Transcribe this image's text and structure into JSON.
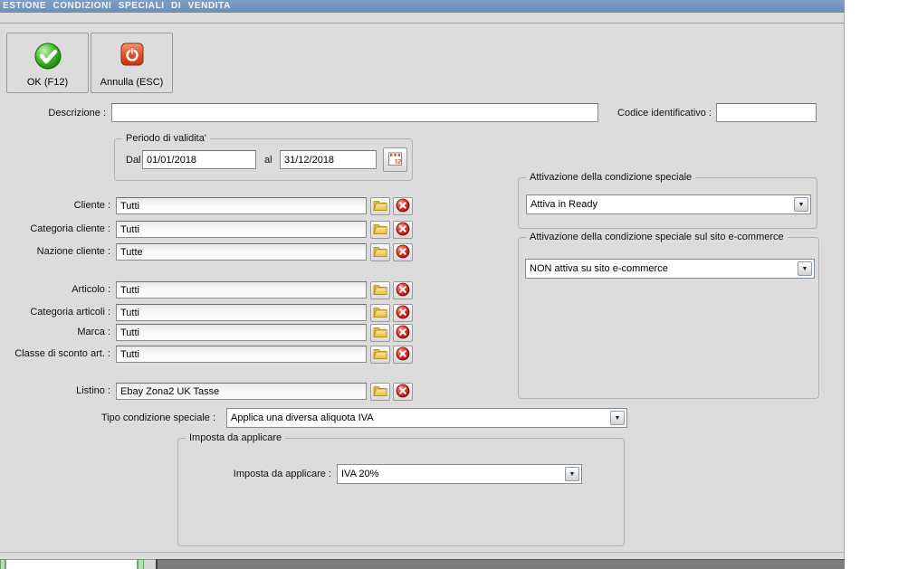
{
  "window": {
    "title": "ESTIONE CONDIZIONI SPECIALI DI VENDITA"
  },
  "toolbar": {
    "ok_label": "OK (F12)",
    "cancel_label": "Annulla (ESC)"
  },
  "fields": {
    "descrizione_label": "Descrizione :",
    "descrizione_value": "",
    "codice_label": "Codice identificativo :",
    "codice_value": ""
  },
  "periodo": {
    "title": "Periodo di validita'",
    "dal_label": "Dal",
    "dal_value": "01/01/2018",
    "al_label": "al",
    "al_value": "31/12/2018"
  },
  "filter_rows": [
    {
      "label": "Cliente :",
      "value": "Tutti"
    },
    {
      "label": "Categoria cliente :",
      "value": "Tutti"
    },
    {
      "label": "Nazione cliente :",
      "value": "Tutte"
    },
    {
      "label": "Articolo :",
      "value": "Tutti"
    },
    {
      "label": "Categoria articoli :",
      "value": "Tutti"
    },
    {
      "label": "Marca :",
      "value": "Tutti"
    },
    {
      "label": "Classe di sconto art. :",
      "value": "Tutti"
    },
    {
      "label": "Listino :",
      "value": "Ebay Zona2 UK Tasse"
    }
  ],
  "attivazione": {
    "title": "Attivazione della condizione speciale",
    "value": "Attiva in Ready"
  },
  "attivazione_ecommerce": {
    "title": "Attivazione della condizione speciale sul sito e-commerce",
    "value": "NON attiva su sito e-commerce"
  },
  "tipo_condizione": {
    "label": "Tipo condizione speciale :",
    "value": "Applica una diversa aliquota IVA"
  },
  "imposta": {
    "group_title": "Imposta da applicare",
    "label": "Imposta da applicare :",
    "value": "IVA 20%"
  },
  "icons": {
    "dropdown_arrow": "▼"
  },
  "colors": {
    "titlebar_blue": "#6c8fba",
    "ok_green": "#2fa51d",
    "cancel_red": "#df4f28",
    "folder_yellow": "#efcb52",
    "clear_red": "#c51414",
    "window_gray": "#dcdcdc"
  }
}
